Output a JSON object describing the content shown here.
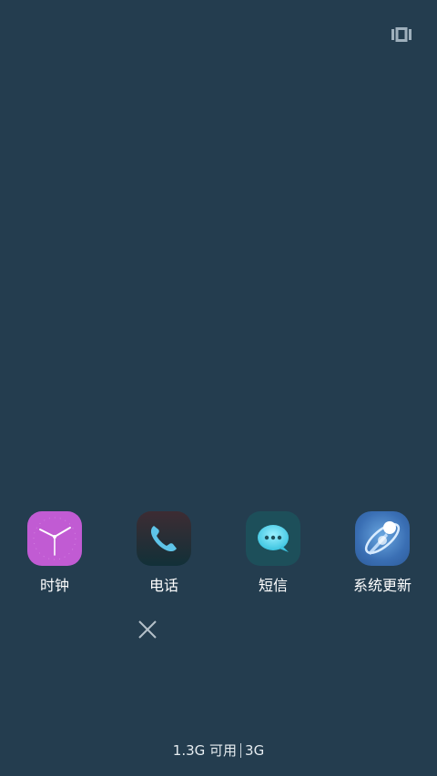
{
  "top_toggle": {
    "icon": "recent-cards-icon"
  },
  "apps": [
    {
      "label": "时钟",
      "icon": "clock-icon",
      "color": "#c15bd3"
    },
    {
      "label": "电话",
      "icon": "phone-icon",
      "color": "#1a3039"
    },
    {
      "label": "短信",
      "icon": "message-icon",
      "color": "#1d4f5a"
    },
    {
      "label": "系统更新",
      "icon": "system-update-icon",
      "color": "#3a6fb4"
    }
  ],
  "close_button": {
    "icon": "close-icon"
  },
  "memory": {
    "available": "1.3G 可用",
    "total": "3G"
  },
  "colors": {
    "background": "#243d4f",
    "text": "#ffffff"
  }
}
